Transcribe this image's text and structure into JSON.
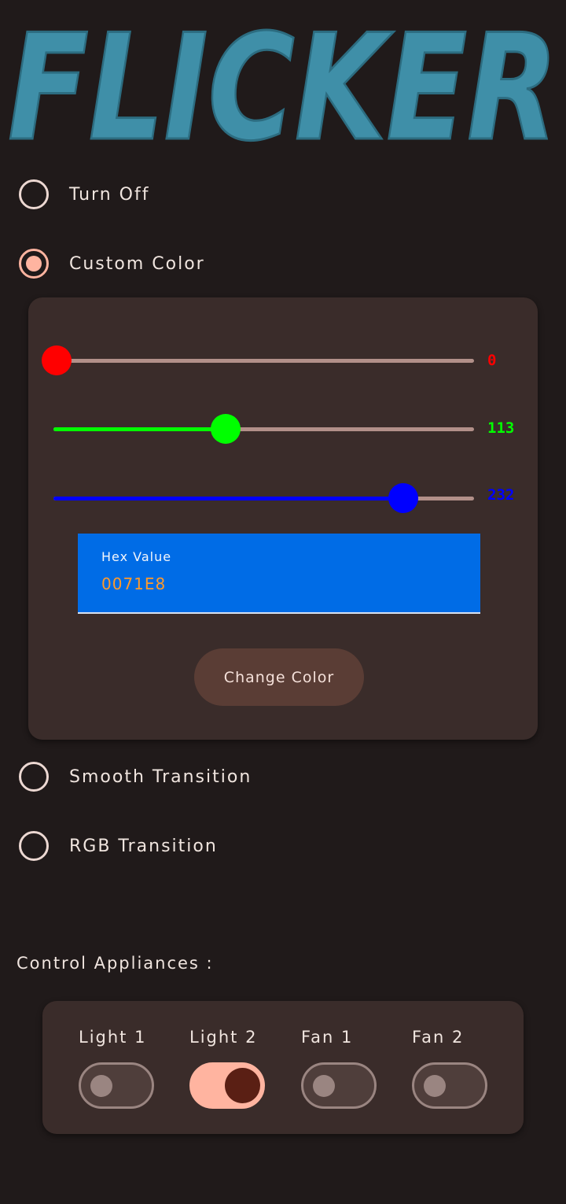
{
  "app": {
    "title": "FLICKER",
    "brand_color": "#3f8fa8"
  },
  "modes": {
    "turn_off": {
      "label": "Turn Off",
      "selected": false
    },
    "custom_color": {
      "label": "Custom Color",
      "selected": true
    },
    "smooth_transition": {
      "label": "Smooth Transition",
      "selected": false
    },
    "rgb_transition": {
      "label": "RGB Transition",
      "selected": false
    }
  },
  "custom": {
    "red": {
      "value": "0",
      "max": 255,
      "color": "#ff0000"
    },
    "green": {
      "value": "113",
      "max": 255,
      "color": "#00ff00"
    },
    "blue": {
      "value": "232",
      "max": 255,
      "color": "#0000ff"
    },
    "hex": {
      "label": "Hex Value",
      "value": "0071E8"
    },
    "button_label": "Change Color"
  },
  "appliances": {
    "title": "Control Appliances :",
    "items": [
      {
        "label": "Light 1",
        "on": false
      },
      {
        "label": "Light 2",
        "on": true
      },
      {
        "label": "Fan 1",
        "on": false
      },
      {
        "label": "Fan 2",
        "on": false
      }
    ]
  }
}
